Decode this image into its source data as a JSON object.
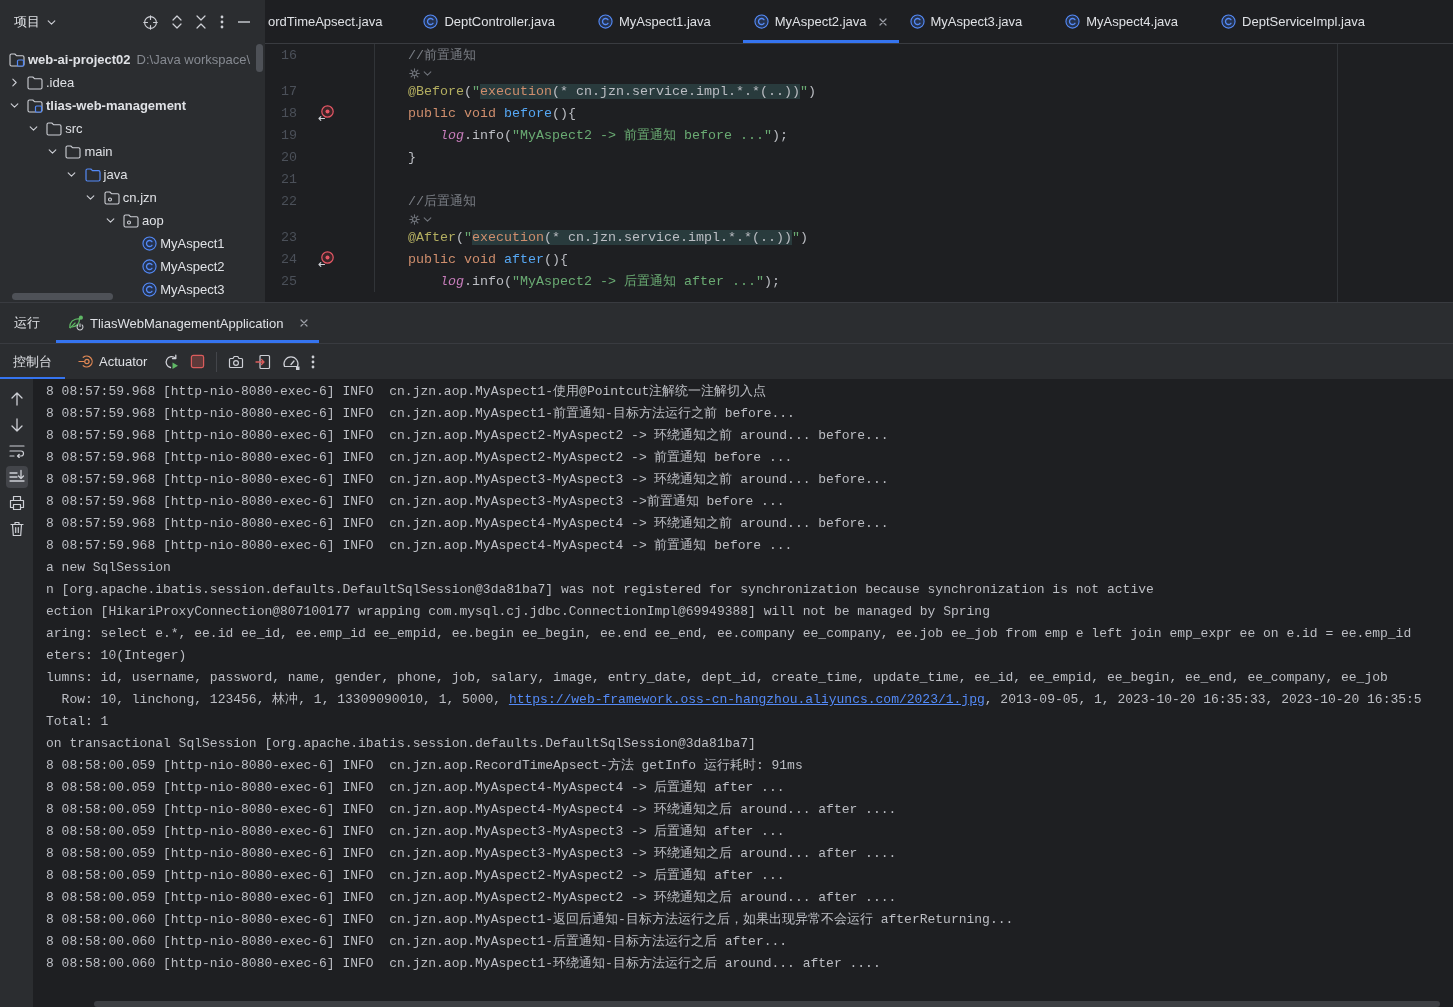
{
  "project_panel": {
    "title": "项目",
    "tree": [
      {
        "label": "web-ai-project02",
        "path": "D:\\Java workspace\\",
        "kind": "module",
        "children": [
          {
            "label": ".idea",
            "kind": "folder",
            "expanded": false
          },
          {
            "label": "tlias-web-management",
            "kind": "module",
            "expanded": true,
            "children": [
              {
                "label": "src",
                "kind": "folder",
                "expanded": true,
                "children": [
                  {
                    "label": "main",
                    "kind": "folder",
                    "expanded": true,
                    "children": [
                      {
                        "label": "java",
                        "kind": "source-folder",
                        "expanded": true,
                        "children": [
                          {
                            "label": "cn.jzn",
                            "kind": "package",
                            "expanded": true,
                            "children": [
                              {
                                "label": "aop",
                                "kind": "package",
                                "expanded": true,
                                "children": [
                                  {
                                    "label": "MyAspect1",
                                    "kind": "class"
                                  },
                                  {
                                    "label": "MyAspect2",
                                    "kind": "class"
                                  },
                                  {
                                    "label": "MyAspect3",
                                    "kind": "class"
                                  }
                                ]
                              }
                            ]
                          }
                        ]
                      }
                    ]
                  }
                ]
              }
            ]
          }
        ]
      }
    ]
  },
  "editor": {
    "tabs": [
      {
        "label": "ordTimeApsect.java",
        "selected": false,
        "clipped": true
      },
      {
        "label": "DeptController.java",
        "selected": false,
        "clipped": false
      },
      {
        "label": "MyAspect1.java",
        "selected": false,
        "clipped": false
      },
      {
        "label": "MyAspect2.java",
        "selected": true,
        "clipped": false
      },
      {
        "label": "MyAspect3.java",
        "selected": false,
        "clipped": false
      },
      {
        "label": "MyAspect4.java",
        "selected": false,
        "clipped": false
      },
      {
        "label": "DeptServiceImpl.java",
        "selected": false,
        "clipped": false
      }
    ],
    "lines": [
      {
        "kind": "line",
        "number": "16",
        "marker": false,
        "tokens": [
          {
            "kind": "comment",
            "text": "//前置通知"
          }
        ]
      },
      {
        "kind": "hint"
      },
      {
        "kind": "line",
        "number": "17",
        "marker": false,
        "tokens": [
          {
            "kind": "annotation",
            "text": "@Before"
          },
          {
            "kind": "plain",
            "text": "("
          },
          {
            "kind": "string",
            "text": "\""
          },
          {
            "kind": "injected-keyword",
            "text": "execution"
          },
          {
            "kind": "injected",
            "text": "(* cn.jzn.service.impl.*.*(..))"
          },
          {
            "kind": "string",
            "text": "\""
          },
          {
            "kind": "plain",
            "text": ")"
          }
        ]
      },
      {
        "kind": "line",
        "number": "18",
        "marker": true,
        "tokens": [
          {
            "kind": "keyword",
            "text": "public void "
          },
          {
            "kind": "method",
            "text": "before"
          },
          {
            "kind": "plain",
            "text": "(){"
          }
        ]
      },
      {
        "kind": "line",
        "number": "19",
        "marker": false,
        "tokens": [
          {
            "kind": "field",
            "text": "    log"
          },
          {
            "kind": "plain",
            "text": ".info("
          },
          {
            "kind": "string",
            "text": "\"MyAspect2 -> 前置通知 before ...\""
          },
          {
            "kind": "plain",
            "text": ");"
          }
        ]
      },
      {
        "kind": "line",
        "number": "20",
        "marker": false,
        "tokens": [
          {
            "kind": "plain",
            "text": "}"
          }
        ]
      },
      {
        "kind": "line",
        "number": "21",
        "marker": false
      },
      {
        "kind": "line",
        "number": "22",
        "marker": false,
        "tokens": [
          {
            "kind": "comment",
            "text": "//后置通知"
          }
        ]
      },
      {
        "kind": "hint"
      },
      {
        "kind": "line",
        "number": "23",
        "marker": false,
        "tokens": [
          {
            "kind": "annotation",
            "text": "@After"
          },
          {
            "kind": "plain",
            "text": "("
          },
          {
            "kind": "string",
            "text": "\""
          },
          {
            "kind": "injected-keyword",
            "text": "execution"
          },
          {
            "kind": "injected",
            "text": "(* cn.jzn.service.impl.*.*(..))"
          },
          {
            "kind": "string",
            "text": "\""
          },
          {
            "kind": "plain",
            "text": ")"
          }
        ]
      },
      {
        "kind": "line",
        "number": "24",
        "marker": true,
        "tokens": [
          {
            "kind": "keyword",
            "text": "public void "
          },
          {
            "kind": "method",
            "text": "after"
          },
          {
            "kind": "plain",
            "text": "(){"
          }
        ]
      },
      {
        "kind": "line",
        "number": "25",
        "marker": false,
        "tokens": [
          {
            "kind": "field",
            "text": "    log"
          },
          {
            "kind": "plain",
            "text": ".info("
          },
          {
            "kind": "string",
            "text": "\"MyAspect2 -> 后置通知 after ...\""
          },
          {
            "kind": "plain",
            "text": ");"
          }
        ]
      }
    ]
  },
  "run_panel": {
    "title": "运行",
    "tabs": [
      {
        "label": "TliasWebManagementApplication",
        "selected": true
      }
    ],
    "subtabs": [
      {
        "kind": "console",
        "label": "控制台",
        "selected": true
      },
      {
        "kind": "actuator",
        "label": "Actuator",
        "selected": false
      }
    ],
    "console": {
      "scroll_to_end": true,
      "lines": [
        {
          "text": "8 08:57:59.968 [http-nio-8080-exec-6] INFO  cn.jzn.aop.MyAspect1-使用@Pointcut注解统一注解切入点"
        },
        {
          "text": "8 08:57:59.968 [http-nio-8080-exec-6] INFO  cn.jzn.aop.MyAspect1-前置通知-目标方法运行之前 before..."
        },
        {
          "text": "8 08:57:59.968 [http-nio-8080-exec-6] INFO  cn.jzn.aop.MyAspect2-MyAspect2 -> 环绕通知之前 around... before..."
        },
        {
          "text": "8 08:57:59.968 [http-nio-8080-exec-6] INFO  cn.jzn.aop.MyAspect2-MyAspect2 -> 前置通知 before ..."
        },
        {
          "text": "8 08:57:59.968 [http-nio-8080-exec-6] INFO  cn.jzn.aop.MyAspect3-MyAspect3 -> 环绕通知之前 around... before..."
        },
        {
          "text": "8 08:57:59.968 [http-nio-8080-exec-6] INFO  cn.jzn.aop.MyAspect3-MyAspect3 ->前置通知 before ..."
        },
        {
          "text": "8 08:57:59.968 [http-nio-8080-exec-6] INFO  cn.jzn.aop.MyAspect4-MyAspect4 -> 环绕通知之前 around... before..."
        },
        {
          "text": "8 08:57:59.968 [http-nio-8080-exec-6] INFO  cn.jzn.aop.MyAspect4-MyAspect4 -> 前置通知 before ..."
        },
        {
          "text": "a new SqlSession"
        },
        {
          "text": "n [org.apache.ibatis.session.defaults.DefaultSqlSession@3da81ba7] was not registered for synchronization because synchronization is not active"
        },
        {
          "text": "ection [HikariProxyConnection@807100177 wrapping com.mysql.cj.jdbc.ConnectionImpl@69949388] will not be managed by Spring"
        },
        {
          "text": "aring: select e.*, ee.id ee_id, ee.emp_id ee_empid, ee.begin ee_begin, ee.end ee_end, ee.company ee_company, ee.job ee_job from emp e left join emp_expr ee on e.id = ee.emp_id"
        },
        {
          "text": "eters: 10(Integer)"
        },
        {
          "text": "lumns: id, username, password, name, gender, phone, job, salary, image, entry_date, dept_id, create_time, update_time, ee_id, ee_empid, ee_begin, ee_end, ee_company, ee_job"
        },
        {
          "text": "  Row: 10, linchong, 123456, 林冲, 1, 13309090010, 1, 5000, ",
          "link": "https://web-framework.oss-cn-hangzhou.aliyuncs.com/2023/1.jpg",
          "text_after": ", 2013-09-05, 1, 2023-10-20 16:35:33, 2023-10-20 16:35:5"
        },
        {
          "text": "Total: 1"
        },
        {
          "text": "on transactional SqlSession [org.apache.ibatis.session.defaults.DefaultSqlSession@3da81ba7]"
        },
        {
          "text": "8 08:58:00.059 [http-nio-8080-exec-6] INFO  cn.jzn.aop.RecordTimeApsect-方法 getInfo 运行耗时: 91ms"
        },
        {
          "text": "8 08:58:00.059 [http-nio-8080-exec-6] INFO  cn.jzn.aop.MyAspect4-MyAspect4 -> 后置通知 after ..."
        },
        {
          "text": "8 08:58:00.059 [http-nio-8080-exec-6] INFO  cn.jzn.aop.MyAspect4-MyAspect4 -> 环绕通知之后 around... after ...."
        },
        {
          "text": "8 08:58:00.059 [http-nio-8080-exec-6] INFO  cn.jzn.aop.MyAspect3-MyAspect3 -> 后置通知 after ..."
        },
        {
          "text": "8 08:58:00.059 [http-nio-8080-exec-6] INFO  cn.jzn.aop.MyAspect3-MyAspect3 -> 环绕通知之后 around... after ...."
        },
        {
          "text": "8 08:58:00.059 [http-nio-8080-exec-6] INFO  cn.jzn.aop.MyAspect2-MyAspect2 -> 后置通知 after ..."
        },
        {
          "text": "8 08:58:00.059 [http-nio-8080-exec-6] INFO  cn.jzn.aop.MyAspect2-MyAspect2 -> 环绕通知之后 around... after ...."
        },
        {
          "text": "8 08:58:00.060 [http-nio-8080-exec-6] INFO  cn.jzn.aop.MyAspect1-返回后通知-目标方法运行之后，如果出现异常不会运行 afterReturning..."
        },
        {
          "text": "8 08:58:00.060 [http-nio-8080-exec-6] INFO  cn.jzn.aop.MyAspect1-后置通知-目标方法运行之后 after..."
        },
        {
          "text": "8 08:58:00.060 [http-nio-8080-exec-6] INFO  cn.jzn.aop.MyAspect1-环绕通知-目标方法运行之后 around... after ...."
        }
      ]
    }
  }
}
